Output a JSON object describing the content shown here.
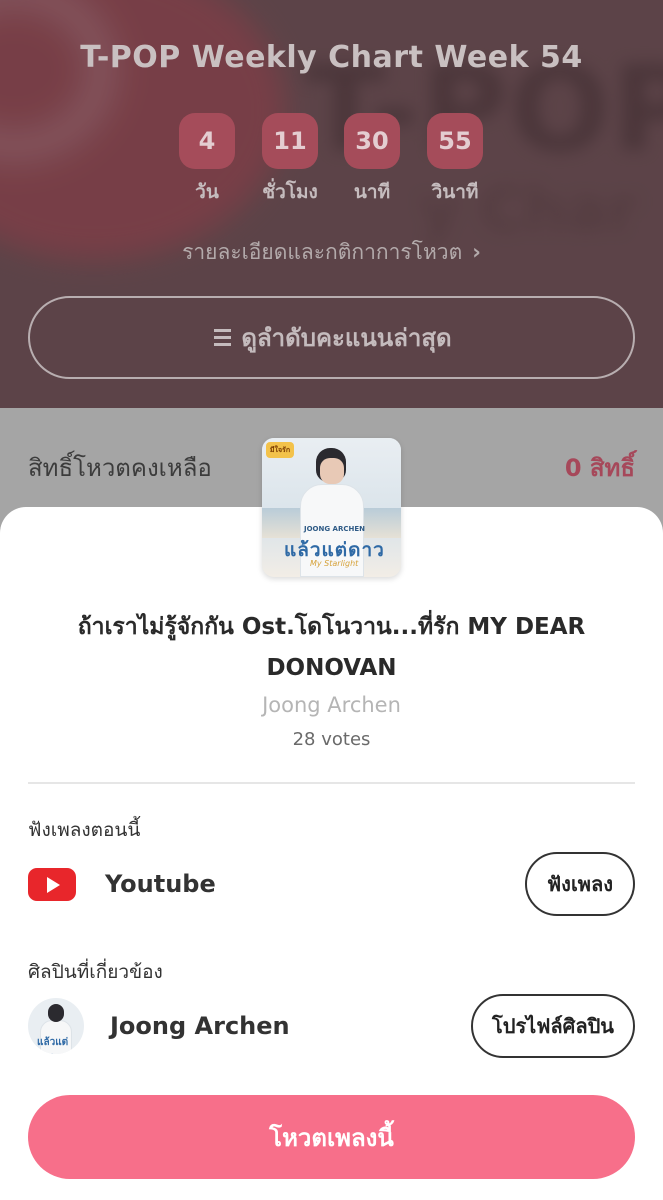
{
  "header": {
    "title": "T-POP Weekly Chart Week 54",
    "countdown": [
      {
        "value": "4",
        "label": "วัน"
      },
      {
        "value": "11",
        "label": "ชั่วโมง"
      },
      {
        "value": "30",
        "label": "นาที"
      },
      {
        "value": "55",
        "label": "วินาที"
      }
    ],
    "rules_link": "รายละเอียดและกติกาการโหวต",
    "ranking_button": "ดูลำดับคะแนนล่าสุด"
  },
  "rights": {
    "label": "สิทธิ์โหวตคงเหลือ",
    "value": "0 สิทธิ์"
  },
  "song": {
    "title": "ถ้าเราไม่รู้จักกัน Ost.โดโนวาน...ที่รัก MY DEAR DONOVAN",
    "artist": "Joong Archen",
    "votes": "28 votes",
    "cover": {
      "logo_text": "มีใจรัก",
      "artist_text": "JOONG ARCHEN",
      "title_text": "แล้วแต่ดาว",
      "subtitle_text": "My Starlight"
    }
  },
  "listen_section": {
    "label": "ฟังเพลงตอนนี้",
    "service_name": "Youtube",
    "service_icon": "youtube-icon",
    "button": "ฟังเพลง"
  },
  "artist_section": {
    "label": "ศิลปินที่เกี่ยวข้อง",
    "artist_name": "Joong  Archen",
    "avatar_text": "แล้วแต่ดาว",
    "button": "โปรไฟล์ศิลปิน"
  },
  "vote_button": "โหวตเพลงนี้",
  "colors": {
    "accent": "#f76f8a",
    "countdown_box": "#a54c5a",
    "rights_value": "#a6485a",
    "youtube_red": "#e8262b"
  }
}
